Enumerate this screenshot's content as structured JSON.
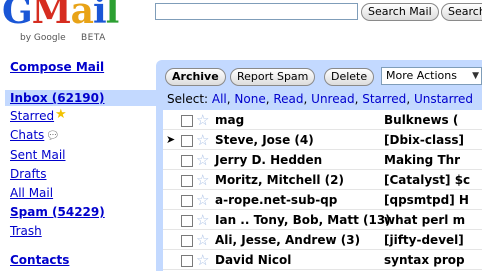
{
  "logo": {
    "text": "Gmail",
    "byline": "by Google",
    "beta": "BETA"
  },
  "search": {
    "input_value": "",
    "mail_button": "Search Mail",
    "web_button": "Search"
  },
  "sidebar": {
    "compose": "Compose Mail",
    "items": [
      {
        "label": "Inbox (62190)",
        "selected": true
      },
      {
        "label": "Starred"
      },
      {
        "label": "Chats"
      },
      {
        "label": "Sent Mail"
      },
      {
        "label": "Drafts"
      },
      {
        "label": "All Mail"
      },
      {
        "label": "Spam (54229)"
      },
      {
        "label": "Trash"
      }
    ],
    "contacts": "Contacts",
    "starred_icon": "gold-star-icon",
    "chats_icon": "chat-bubble-icon"
  },
  "toolbar": {
    "archive": "Archive",
    "report_spam": "Report Spam",
    "delete": "Delete",
    "more_actions": "More Actions"
  },
  "select_line": {
    "prefix": "Select:",
    "all": "All",
    "none": "None",
    "read": "Read",
    "unread": "Unread",
    "starred": "Starred",
    "unstarred": "Unstarred"
  },
  "messages": [
    {
      "sender": "mag",
      "subject": "Bulknews (",
      "current": false
    },
    {
      "sender": "Steve, Jose (4)",
      "subject": "[Dbix-class]",
      "current": true
    },
    {
      "sender": "Jerry D. Hedden",
      "subject": "Making Thr",
      "current": false
    },
    {
      "sender": "Moritz, Mitchell (2)",
      "subject": "[Catalyst] $c",
      "current": false
    },
    {
      "sender": "a-rope.net-sub-qp",
      "subject": "[qpsmtpd] H",
      "current": false
    },
    {
      "sender": "Ian .. Tony, Bob, Matt (13)",
      "subject": "what perl m",
      "current": false
    },
    {
      "sender": "Ali, Jesse, Andrew (3)",
      "subject": "[jifty-devel]",
      "current": false
    },
    {
      "sender": "David Nicol",
      "subject": "syntax prop",
      "current": false
    }
  ],
  "colors": {
    "panel": "#c3d9ff",
    "link": "#0000cc"
  }
}
